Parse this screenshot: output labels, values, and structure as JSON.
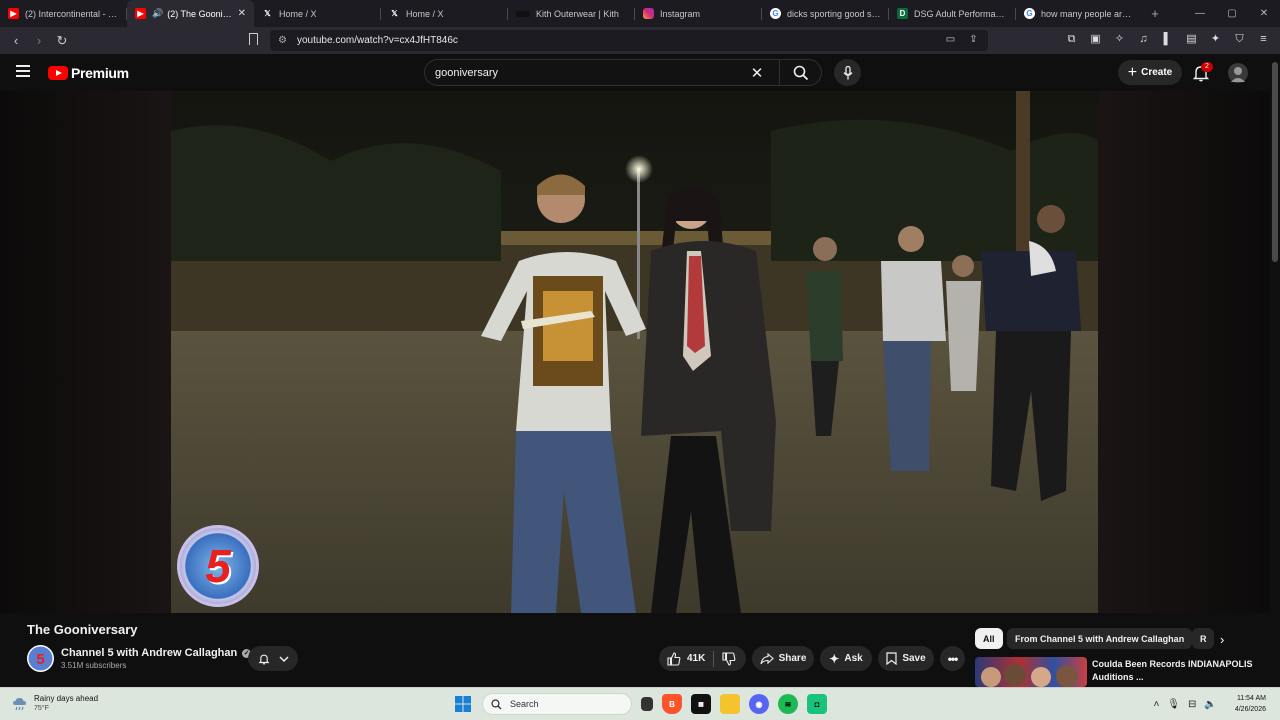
{
  "browser": {
    "tabs": [
      {
        "title": "(2) Intercontinental - YouT",
        "favicon": "youtube",
        "active": false
      },
      {
        "title": "(2) The Gooniversa",
        "favicon": "youtube",
        "active": true,
        "audio": true
      },
      {
        "title": "Home / X",
        "favicon": "x",
        "active": false
      },
      {
        "title": "Home / X",
        "favicon": "x",
        "active": false
      },
      {
        "title": "Kith Outerwear | Kith",
        "favicon": "kith",
        "active": false
      },
      {
        "title": "Instagram",
        "favicon": "instagram",
        "active": false
      },
      {
        "title": "dicks sporting good shies",
        "favicon": "google",
        "active": false
      },
      {
        "title": "DSG Adult Performance Be",
        "favicon": "dsg",
        "active": false
      },
      {
        "title": "how many people are in th",
        "favicon": "google",
        "active": false
      }
    ],
    "url": "youtube.com/watch?v=cx4JfHT846c"
  },
  "youtube": {
    "logo_text": "Premium",
    "search_query": "gooniversary",
    "create_label": "Create",
    "notification_count": "2"
  },
  "video": {
    "title": "The Gooniversary",
    "channel_name": "Channel 5 with Andrew Callaghan",
    "subscribers": "3.51M subscribers",
    "likes": "41K",
    "share_label": "Share",
    "ask_label": "Ask",
    "save_label": "Save",
    "overlay_logo": "5"
  },
  "sidebar": {
    "chips": [
      "All",
      "From Channel 5 with Andrew Callaghan",
      "R"
    ],
    "rec_title": "Coulda Been Records INDIANAPOLIS Auditions ..."
  },
  "taskbar": {
    "weather_title": "Rainy days ahead",
    "weather_temp": "75°F",
    "search_placeholder": "Search",
    "time": "11:54 AM",
    "date": "4/26/2026"
  }
}
